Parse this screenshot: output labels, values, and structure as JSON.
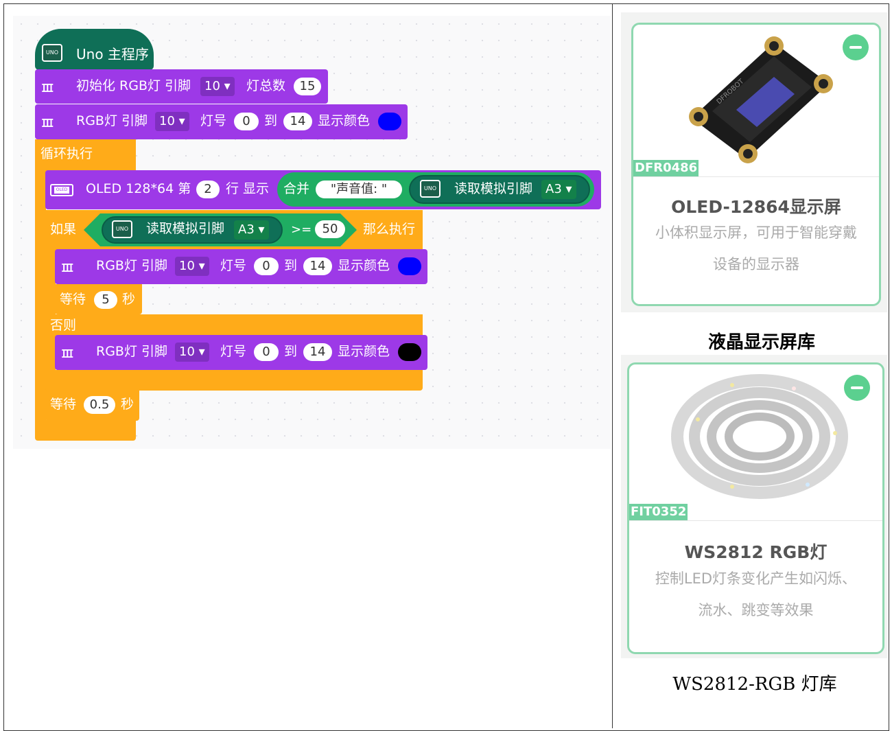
{
  "main_program": {
    "title": "Uno 主程序"
  },
  "init_block": {
    "label": "初始化 RGB灯 引脚",
    "pin": "10 ▾",
    "count_label": "灯总数",
    "count": "15"
  },
  "rgb_block_1": {
    "label": "RGB灯 引脚",
    "pin": "10 ▾",
    "lamp_label": "灯号",
    "from": "0",
    "to_label": "到",
    "to": "14",
    "color_label": "显示颜色",
    "color": "#0000ff"
  },
  "loop_block": {
    "label": "循环执行"
  },
  "oled_block": {
    "label": "OLED 128*64 第",
    "row": "2",
    "row_label": "行 显示",
    "icon": "OLED",
    "join_label": "合并",
    "text": "\"声音值: \"",
    "read_label": "读取模拟引脚",
    "pin": "A3 ▾"
  },
  "if_block": {
    "if_label": "如果",
    "read_label": "读取模拟引脚",
    "pin": "A3 ▾",
    "op": ">=",
    "value": "50",
    "then_label": "那么执行"
  },
  "rgb_block_2": {
    "label": "RGB灯 引脚",
    "pin": "10 ▾",
    "lamp_label": "灯号",
    "from": "0",
    "to_label": "到",
    "to": "14",
    "color_label": "显示颜色",
    "color": "#0000ff"
  },
  "wait_block_1": {
    "label": "等待",
    "value": "5",
    "unit": "秒"
  },
  "else_block": {
    "label": "否则"
  },
  "rgb_block_3": {
    "label": "RGB灯 引脚",
    "pin": "10 ▾",
    "lamp_label": "灯号",
    "from": "0",
    "to_label": "到",
    "to": "14",
    "color_label": "显示颜色",
    "color": "#000000"
  },
  "wait_block_2": {
    "label": "等待",
    "value": "0.5",
    "unit": "秒"
  },
  "uno_icon": "UNO",
  "library_cards": [
    {
      "code": "DFR0486",
      "title": "OLED-12864显示屏",
      "desc_line1": "小体积显示屏，可用于智能穿戴",
      "desc_line2": "设备的显示器",
      "caption": "液晶显示屏库",
      "image_text": "DFROBOT"
    },
    {
      "code": "FIT0352",
      "title": "WS2812 RGB灯",
      "desc_line1": "控制LED灯条变化产生如闪烁、",
      "desc_line2": "流水、跳变等效果",
      "caption": "WS2812-RGB 灯库"
    }
  ],
  "colors": {
    "purple": "#9d39e7",
    "orange": "#ffab19",
    "teal": "#0f6f57",
    "green": "#1fad62",
    "card_border": "#8fd8b0"
  }
}
